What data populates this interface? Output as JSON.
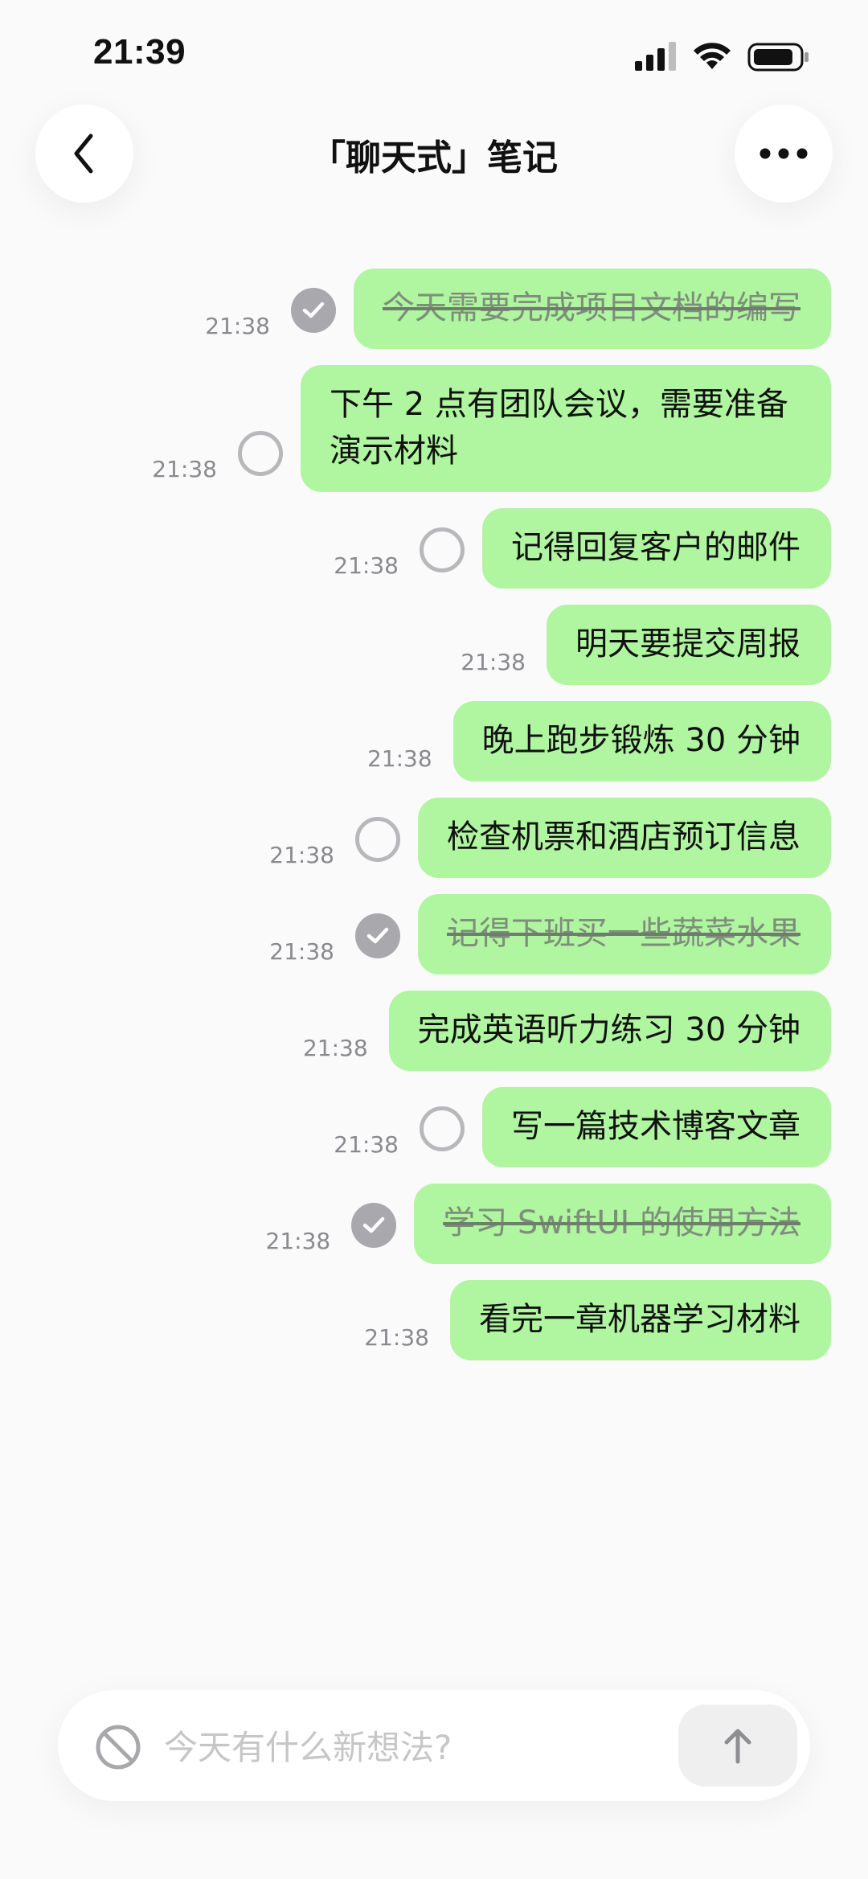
{
  "status_bar": {
    "time": "21:39"
  },
  "header": {
    "title": "「聊天式」笔记"
  },
  "messages": [
    {
      "time": "21:38",
      "text": "今天需要完成项目文档的编写",
      "state": "done"
    },
    {
      "time": "21:38",
      "text": "下午 2 点有团队会议，需要准备演示材料",
      "state": "open"
    },
    {
      "time": "21:38",
      "text": "记得回复客户的邮件",
      "state": "open"
    },
    {
      "time": "21:38",
      "text": "明天要提交周报",
      "state": "none"
    },
    {
      "time": "21:38",
      "text": "晚上跑步锻炼 30 分钟",
      "state": "none"
    },
    {
      "time": "21:38",
      "text": "检查机票和酒店预订信息",
      "state": "open"
    },
    {
      "time": "21:38",
      "text": "记得下班买一些蔬菜水果",
      "state": "done"
    },
    {
      "time": "21:38",
      "text": "完成英语听力练习 30 分钟",
      "state": "none"
    },
    {
      "time": "21:38",
      "text": "写一篇技术博客文章",
      "state": "open"
    },
    {
      "time": "21:38",
      "text": "学习 SwiftUI 的使用方法",
      "state": "done"
    },
    {
      "time": "21:38",
      "text": "看完一章机器学习材料",
      "state": "none"
    }
  ],
  "composer": {
    "placeholder": "今天有什么新想法?"
  },
  "colors": {
    "bubble": "#b0f5a0",
    "check_done": "#a9a9ad",
    "check_open": "#b8b8bb"
  },
  "icons": {
    "back": "chevron-left-icon",
    "more": "ellipsis-icon",
    "composer_left": "prohibited-icon",
    "send": "arrow-up-icon",
    "done": "checkmark-icon"
  }
}
